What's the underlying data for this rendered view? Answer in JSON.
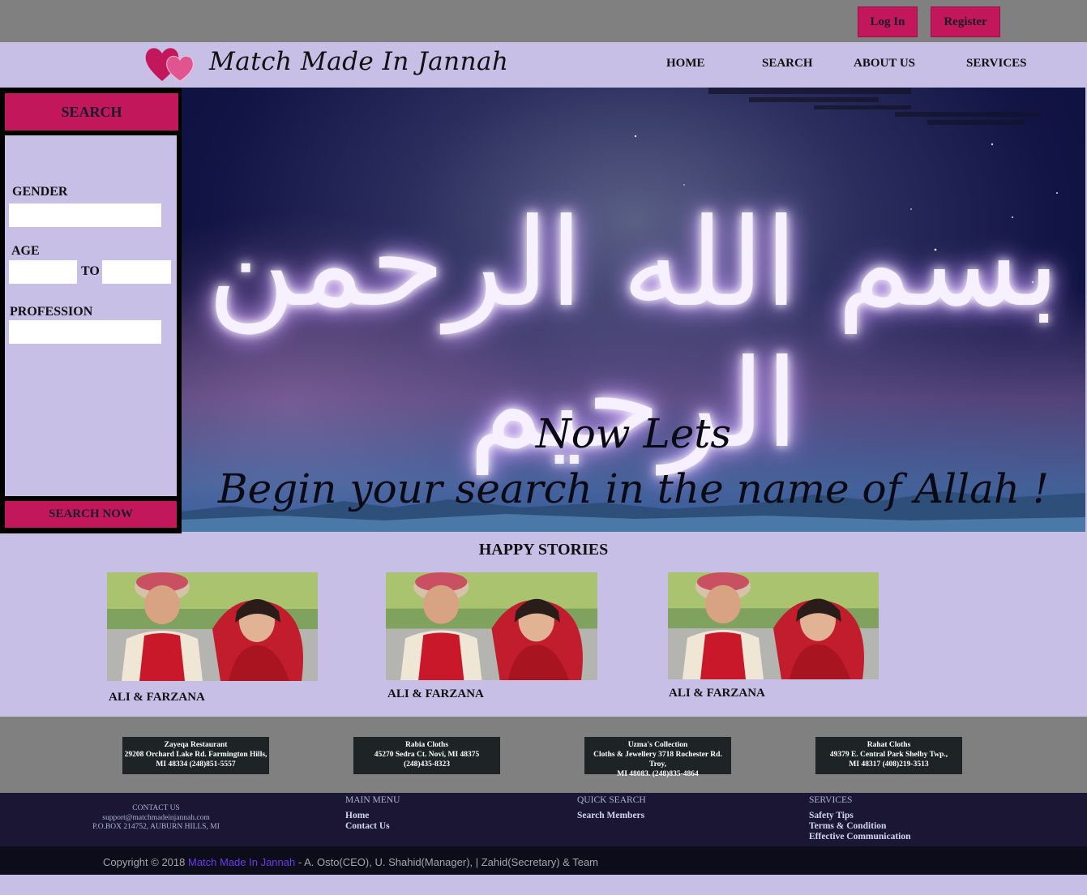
{
  "top": {
    "login_label": "Log In",
    "register_label": "Register"
  },
  "brand": {
    "name": "Match Made In Jannah"
  },
  "nav": {
    "home": "HOME",
    "search": "SEARCH",
    "about": "ABOUT US",
    "services": "SERVICES"
  },
  "search_panel": {
    "title": "SEARCH",
    "gender_label": "GENDER",
    "gender_value": "",
    "age_label": "AGE",
    "age_from": "",
    "age_to_label": "TO",
    "age_to": "",
    "profession_label": "PROFESSION",
    "profession_value": "",
    "submit_label": "SEARCH NOW"
  },
  "hero": {
    "calligraphy": "بسم الله الرحمن الرحيم",
    "line1": "Now Lets",
    "line2": "Begin your search in the name of Allah !"
  },
  "stories": {
    "title": "HAPPY STORIES",
    "items": [
      {
        "caption": "ALI & FARZANA"
      },
      {
        "caption": "ALI & FARZANA"
      },
      {
        "caption": "ALI & FARZANA"
      }
    ]
  },
  "sponsors": [
    {
      "name": "Zayeqa Restaurant",
      "line1": "29208 Orchard Lake Rd. Farmington Hills,",
      "line2": "MI 48334 (248)851-5557"
    },
    {
      "name": "Rabia Cloths",
      "line1": "45270 Sedra Ct. Novi, MI 48375",
      "line2": "(248)435-8323"
    },
    {
      "name": "Uzma's Collection",
      "line1": "Cloths & Jewellery 3718 Rochester Rd. Troy,",
      "line2": "MI 48083.  (248)835-4864"
    },
    {
      "name": "Rahat Cloths",
      "line1": "49379 E. Central Park Shelby Twp.,",
      "line2": "MI 48317  (408)219-3513"
    }
  ],
  "footer": {
    "contact_title": "CONTACT US",
    "contact_email": "support@matchmadeinjannah.com",
    "contact_address": "P.O.BOX 214752, AUBURN HILLS, MI",
    "main_menu_title": "MAIN MENU",
    "main_menu_home": "Home",
    "main_menu_contact": "Contact Us",
    "quick_search_title": "QUICK SEARCH",
    "quick_search_members": "Search Members",
    "services_title": "SERVICES",
    "services_safety": "Safety Tips",
    "services_terms": "Terms & Condition",
    "services_comm": "Effective Communication",
    "copyright_prefix": "Copyright © 2018 ",
    "copyright_brand": "Match Made In Jannah",
    "copyright_suffix": " - A. Osto(CEO), U. Shahid(Manager), | Zahid(Secretary) & Team"
  },
  "colors": {
    "accent": "#c2185b",
    "panel": "#c8bfe6",
    "footer": "#1b1634"
  }
}
